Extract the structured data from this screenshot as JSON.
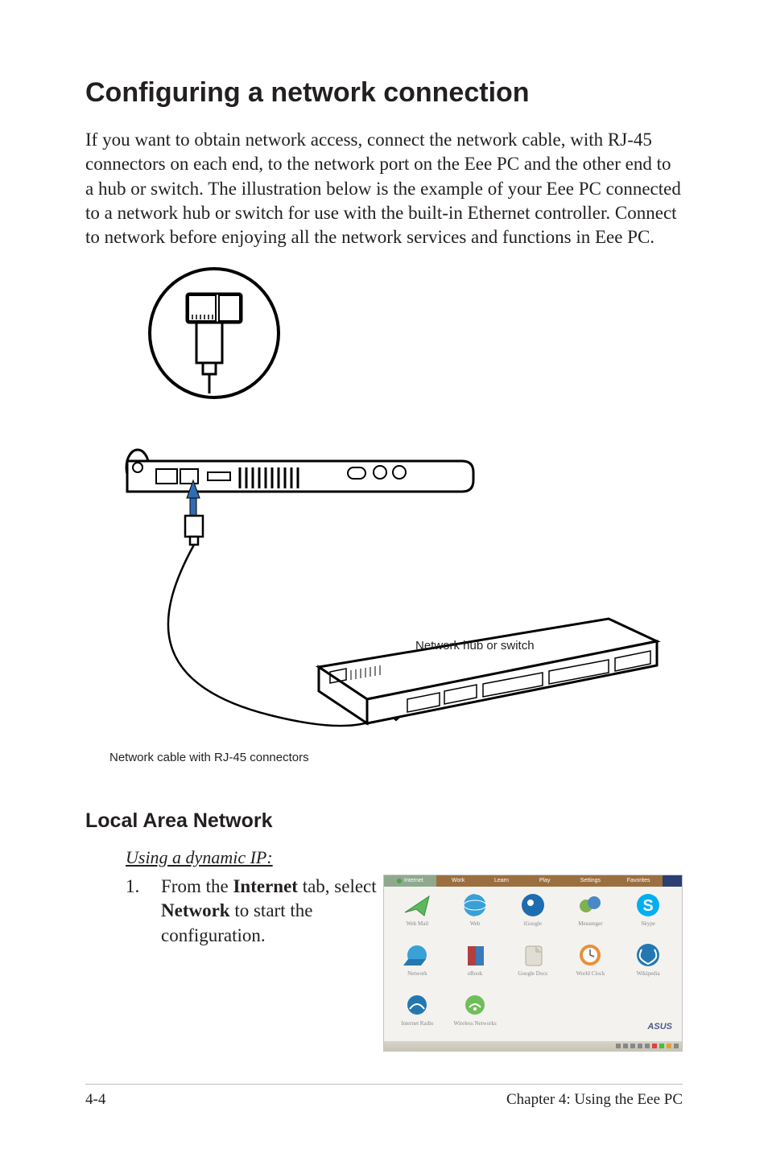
{
  "heading": "Configuring a network connection",
  "intro": "If you want to obtain network access, connect the network cable, with RJ-45 connectors on each end, to the network port on the Eee PC and the other end to a hub or switch. The illustration below is the example of your Eee PC connected to a network hub or switch for use with the built-in Ethernet controller. Connect to network before enjoying all the network services and functions in Eee PC.",
  "figure": {
    "hub_label": "Network hub or switch",
    "cable_caption": "Network cable with RJ-45 connectors"
  },
  "lan_heading": "Local Area Network",
  "dyn_heading": "Using a dynamic IP:",
  "step1": {
    "num": "1.",
    "pre": "From the ",
    "bold1": "Internet",
    "mid": " tab, select ",
    "bold2": "Network",
    "post": " to start the configuration."
  },
  "screenshot": {
    "tabs": [
      "Internet",
      "Work",
      "Learn",
      "Play",
      "Settings",
      "Favorites"
    ],
    "icons": [
      "Web Mail",
      "Web",
      "iGoogle",
      "Messenger",
      "Skype",
      "Network",
      "eBook",
      "Google Docs",
      "World Clock",
      "Wikipedia",
      "Internet Radio",
      "Wireless Networks"
    ],
    "brand": "ASUS"
  },
  "footer": {
    "left": "4-4",
    "right": "Chapter 4: Using the Eee PC"
  }
}
